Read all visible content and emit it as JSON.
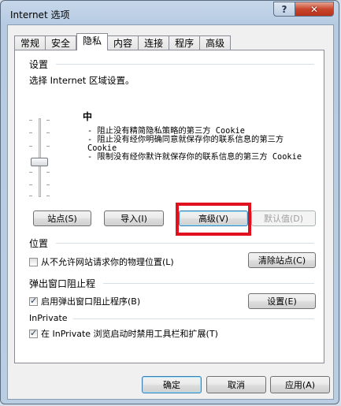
{
  "window": {
    "title": "Internet 选项",
    "help_label": "?",
    "close_label": "✕"
  },
  "tabs": [
    "常规",
    "安全",
    "隐私",
    "内容",
    "连接",
    "程序",
    "高级"
  ],
  "active_tab": "隐私",
  "settings": {
    "label": "设置",
    "instruction": "选择 Internet 区域设置。",
    "level": "中",
    "bullets": [
      "- 阻止没有精简隐私策略的第三方 Cookie",
      "- 阻止没有经你明确同意就保存你的联系信息的第三方 Cookie",
      "- 限制没有经你默许就保存你的联系信息的第三方 Cookie"
    ],
    "buttons": {
      "sites": "站点(S)",
      "import": "导入(I)",
      "advanced": "高级(V)",
      "default": "默认值(D)"
    }
  },
  "location": {
    "label": "位置",
    "checkbox": "从不允许网站请求你的物理位置(L)",
    "checked": false,
    "clear_button": "清除站点(C)"
  },
  "popup": {
    "label": "弹出窗口阻止程",
    "checkbox": "启用弹出窗口阻止程序(B)",
    "checked": true,
    "settings_button": "设置(E)"
  },
  "inprivate": {
    "label": "InPrivate",
    "checkbox": "在 InPrivate 浏览启动时禁用工具栏和扩展(T)",
    "checked": true
  },
  "footer": {
    "ok": "确定",
    "cancel": "取消",
    "apply": "应用(A)"
  },
  "colors": {
    "highlight_box": "#e0101c",
    "close_button": "#c8472d"
  }
}
